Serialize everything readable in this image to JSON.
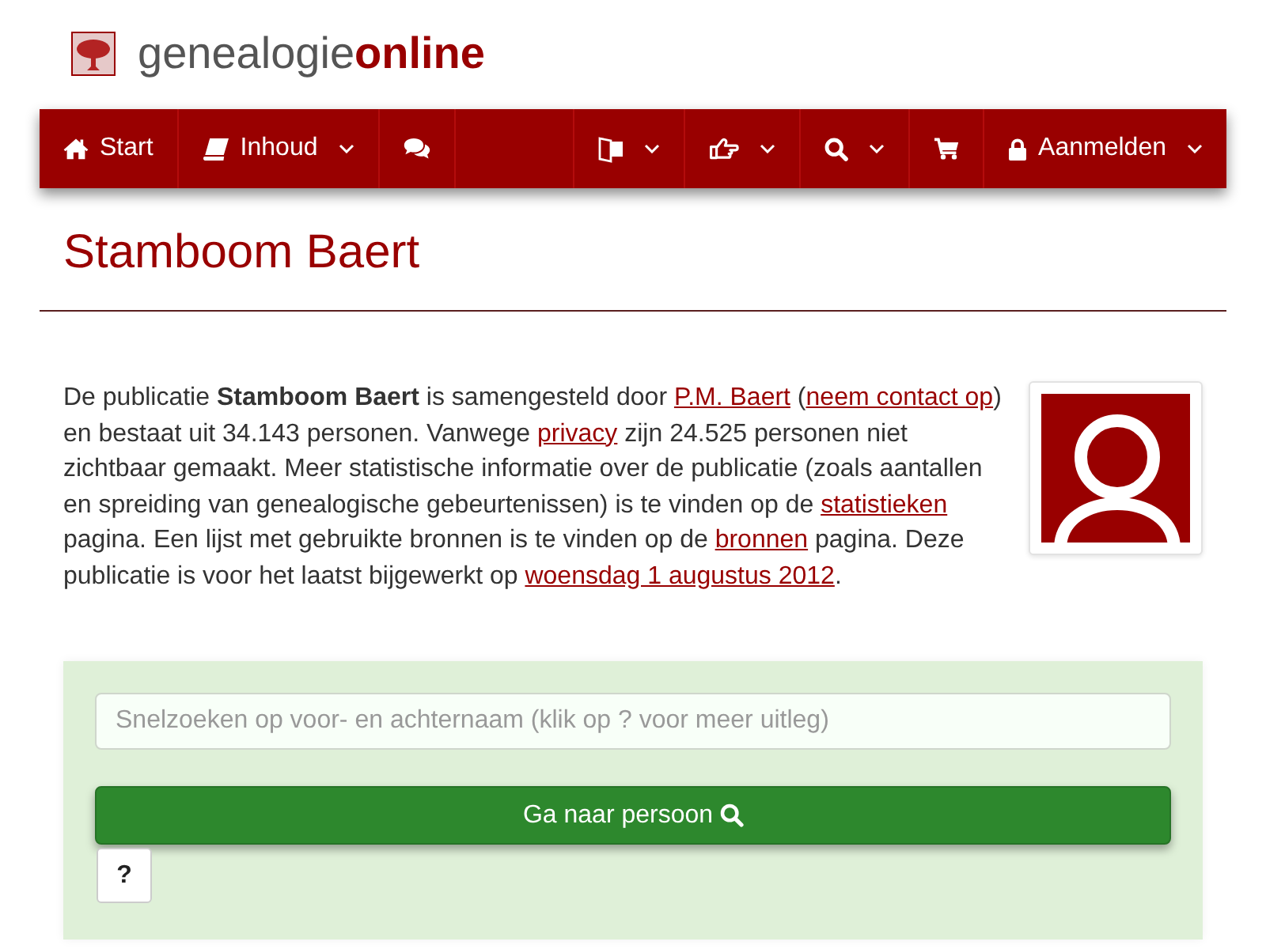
{
  "header": {
    "logo_text": "genealogie**online**"
  },
  "nav": {
    "start": {
      "label": "Start",
      "menu": false
    },
    "contents": {
      "label": "Inhoud",
      "menu": true
    },
    "chat": {
      "menu": false
    },
    "language": {
      "menu": true
    },
    "contribute": {
      "menu": true
    },
    "search": {
      "menu": true
    },
    "shop": {
      "menu": false
    },
    "account": {
      "label": "Aanmelden",
      "menu": true
    }
  },
  "page_title": "Stamboom Baert",
  "intro": {
    "segments": [
      {
        "kind": "text",
        "text": "De publicatie **Stamboom Baert** is samengesteld door "
      },
      {
        "kind": "link",
        "text": "P.M. Baert"
      },
      {
        "kind": "text",
        "text": " ("
      },
      {
        "kind": "link",
        "text": "neem contact op"
      },
      {
        "kind": "text",
        "text": ") en bestaat uit 34.143 personen. Vanwege "
      },
      {
        "kind": "link",
        "text": "privacy"
      },
      {
        "kind": "text",
        "text": " zijn 24.525 personen niet zichtbaar gemaakt. Meer statistische informatie over de publicatie (zoals aantallen en spreiding van genealogische gebeurtenissen) is te vinden op de "
      },
      {
        "kind": "link",
        "text": "statistieken"
      },
      {
        "kind": "text",
        "text": " pagina. Een lijst met gebruikte bronnen is te vinden op de "
      },
      {
        "kind": "link",
        "text": "bronnen"
      },
      {
        "kind": "text",
        "text": " pagina. Deze publicatie is voor het laatst bijgewerkt op "
      },
      {
        "kind": "link",
        "text": "woensdag 1 augustus 2012"
      },
      {
        "kind": "text",
        "text": "."
      }
    ]
  },
  "quick_search": {
    "placeholder": "Snelzoeken op voor- en achternaam (klik op ? voor meer uitleg)",
    "submit_label": "Ga naar persoon",
    "help_label": "?"
  }
}
